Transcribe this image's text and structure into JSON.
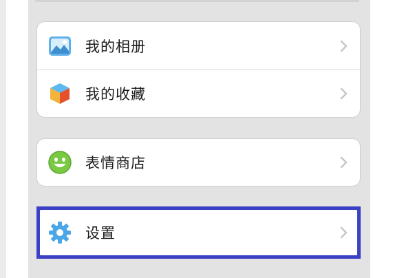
{
  "menu": {
    "groups": [
      {
        "items": [
          {
            "label": "我的相册",
            "icon": "photo-album-icon"
          },
          {
            "label": "我的收藏",
            "icon": "favorites-cube-icon"
          }
        ]
      },
      {
        "items": [
          {
            "label": "表情商店",
            "icon": "smiley-icon"
          }
        ]
      },
      {
        "items": [
          {
            "label": "设置",
            "icon": "gear-icon"
          }
        ]
      }
    ]
  },
  "colors": {
    "background": "#e4e3e3",
    "highlight": "#3b40c5",
    "chevron": "#c7c7c7",
    "smiley": "#7ac943",
    "gear": "#4aa6e6",
    "album": "#5fb0e8"
  }
}
